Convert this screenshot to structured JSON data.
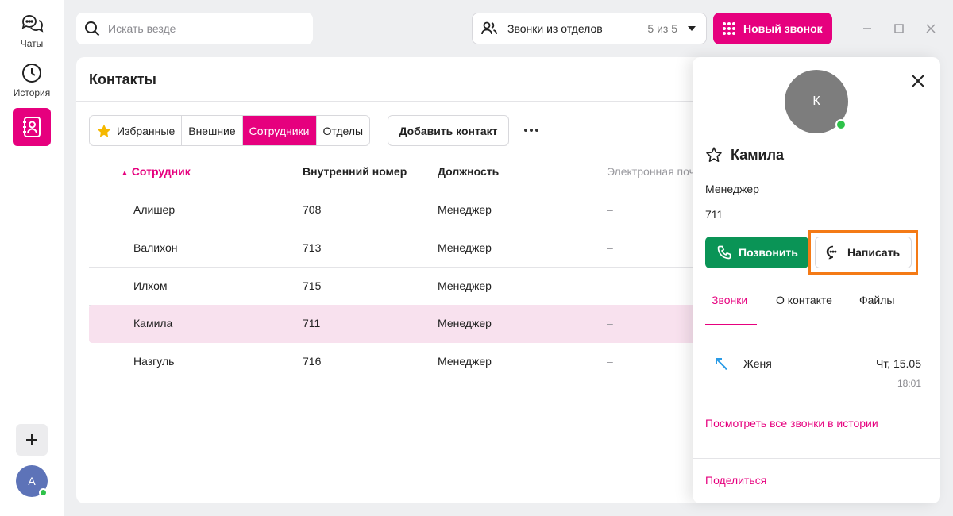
{
  "rail": {
    "chats_label": "Чаты",
    "history_label": "История",
    "avatar_initial": "А"
  },
  "topbar": {
    "search_placeholder": "Искать везде",
    "dept_label": "Звонки из отделов",
    "dept_count": "5 из 5",
    "new_call_label": "Новый звонок"
  },
  "contacts": {
    "title": "Контакты",
    "segments": [
      "Избранные",
      "Внешние",
      "Сотрудники",
      "Отделы"
    ],
    "active_segment": "Сотрудники",
    "add_contact_label": "Добавить контакт",
    "columns": [
      "Сотрудник",
      "Внутренний номер",
      "Должность",
      "Электронная поч"
    ],
    "rows": [
      {
        "name": "Алишер",
        "ext": "708",
        "role": "Менеджер",
        "email": "–"
      },
      {
        "name": "Валихон",
        "ext": "713",
        "role": "Менеджер",
        "email": "–"
      },
      {
        "name": "Илхом",
        "ext": "715",
        "role": "Менеджер",
        "email": "–"
      },
      {
        "name": "Камила",
        "ext": "711",
        "role": "Менеджер",
        "email": "–"
      },
      {
        "name": "Назгуль",
        "ext": "716",
        "role": "Менеджер",
        "email": "–"
      }
    ],
    "selected_row": "Камила"
  },
  "drawer": {
    "avatar_initial": "К",
    "name": "Камила",
    "role": "Менеджер",
    "number": "711",
    "call_label": "Позвонить",
    "write_label": "Написать",
    "tabs": [
      "Звонки",
      "О контакте",
      "Файлы"
    ],
    "active_tab": "Звонки",
    "calls": [
      {
        "name": "Женя",
        "date": "Чт, 15.05",
        "time": "18:01"
      }
    ],
    "history_link": "Посмотреть все звонки в истории",
    "share_link": "Поделиться"
  },
  "colors": {
    "accent": "#e6007e",
    "call_green": "#0a9456",
    "online": "#2fc24a",
    "highlight": "#f47a16"
  }
}
